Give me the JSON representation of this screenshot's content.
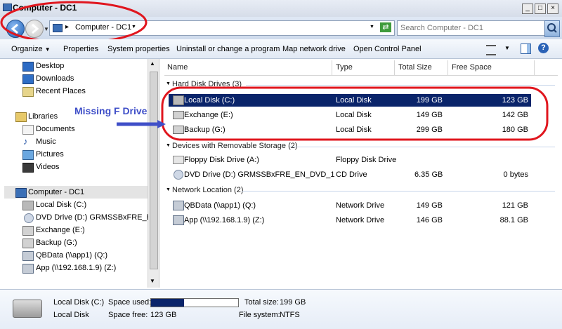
{
  "window": {
    "title": "Computer - DC1",
    "controls": [
      "_",
      "□",
      "×"
    ]
  },
  "address": {
    "path": "Computer - DC1",
    "search_placeholder": "Search Computer - DC1"
  },
  "toolbar": {
    "items": [
      "Organize",
      "Properties",
      "System properties",
      "Uninstall or change a program",
      "Map network drive",
      "Open Control Panel"
    ]
  },
  "nav": {
    "favorites": [
      "Desktop",
      "Downloads",
      "Recent Places"
    ],
    "libraries_label": "Libraries",
    "libraries": [
      "Documents",
      "Music",
      "Pictures",
      "Videos"
    ],
    "computer_label": "Computer - DC1",
    "computer_items": [
      "Local Disk (C:)",
      "DVD Drive (D:) GRMSSBxFRE_EN_D",
      "Exchange (E:)",
      "Backup (G:)",
      "QBData (\\\\app1) (Q:)",
      "App (\\\\192.168.1.9) (Z:)"
    ]
  },
  "columns": [
    "Name",
    "Type",
    "Total Size",
    "Free Space"
  ],
  "groups": {
    "hdd": "Hard Disk Drives (3)",
    "removable": "Devices with Removable Storage (2)",
    "network": "Network Location (2)"
  },
  "rows": {
    "hdd": [
      {
        "name": "Local Disk (C:)",
        "type": "Local Disk",
        "total": "199 GB",
        "free": "123 GB"
      },
      {
        "name": "Exchange (E:)",
        "type": "Local Disk",
        "total": "149 GB",
        "free": "142 GB"
      },
      {
        "name": "Backup (G:)",
        "type": "Local Disk",
        "total": "299 GB",
        "free": "180 GB"
      }
    ],
    "removable": [
      {
        "name": "Floppy Disk Drive (A:)",
        "type": "Floppy Disk Drive",
        "total": "",
        "free": ""
      },
      {
        "name": "DVD Drive (D:) GRMSSBxFRE_EN_DVD_1",
        "type": "CD Drive",
        "total": "6.35 GB",
        "free": "0 bytes"
      }
    ],
    "network": [
      {
        "name": "QBData (\\\\app1) (Q:)",
        "type": "Network Drive",
        "total": "149 GB",
        "free": "121 GB"
      },
      {
        "name": "App (\\\\192.168.1.9) (Z:)",
        "type": "Network Drive",
        "total": "146 GB",
        "free": "88.1 GB"
      }
    ]
  },
  "annotation": {
    "text": "Missing F Drive",
    "color": "#3f4fc8",
    "circle_color": "#e0161e"
  },
  "details": {
    "drive_name": "Local Disk (C:)",
    "drive_type": "Local Disk",
    "space_used_label": "Space used:",
    "space_used_fraction": 0.38,
    "space_free_label": "Space free:",
    "space_free_value": "123 GB",
    "total_size_label": "Total size:",
    "total_size_value": "199 GB",
    "file_system_label": "File system:",
    "file_system_value": "NTFS"
  },
  "colors": {
    "selection": "#0a246a",
    "progress": "#0a246a"
  }
}
